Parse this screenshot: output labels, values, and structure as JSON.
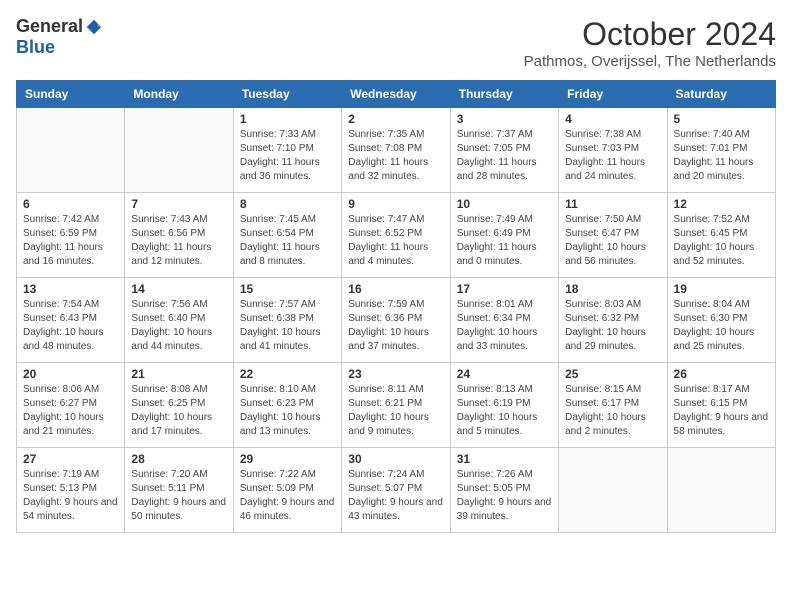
{
  "header": {
    "logo_general": "General",
    "logo_blue": "Blue",
    "month_year": "October 2024",
    "location": "Pathmos, Overijssel, The Netherlands"
  },
  "days_of_week": [
    "Sunday",
    "Monday",
    "Tuesday",
    "Wednesday",
    "Thursday",
    "Friday",
    "Saturday"
  ],
  "weeks": [
    [
      {
        "day": "",
        "content": ""
      },
      {
        "day": "",
        "content": ""
      },
      {
        "day": "1",
        "content": "Sunrise: 7:33 AM\nSunset: 7:10 PM\nDaylight: 11 hours and 36 minutes."
      },
      {
        "day": "2",
        "content": "Sunrise: 7:35 AM\nSunset: 7:08 PM\nDaylight: 11 hours and 32 minutes."
      },
      {
        "day": "3",
        "content": "Sunrise: 7:37 AM\nSunset: 7:05 PM\nDaylight: 11 hours and 28 minutes."
      },
      {
        "day": "4",
        "content": "Sunrise: 7:38 AM\nSunset: 7:03 PM\nDaylight: 11 hours and 24 minutes."
      },
      {
        "day": "5",
        "content": "Sunrise: 7:40 AM\nSunset: 7:01 PM\nDaylight: 11 hours and 20 minutes."
      }
    ],
    [
      {
        "day": "6",
        "content": "Sunrise: 7:42 AM\nSunset: 6:59 PM\nDaylight: 11 hours and 16 minutes."
      },
      {
        "day": "7",
        "content": "Sunrise: 7:43 AM\nSunset: 6:56 PM\nDaylight: 11 hours and 12 minutes."
      },
      {
        "day": "8",
        "content": "Sunrise: 7:45 AM\nSunset: 6:54 PM\nDaylight: 11 hours and 8 minutes."
      },
      {
        "day": "9",
        "content": "Sunrise: 7:47 AM\nSunset: 6:52 PM\nDaylight: 11 hours and 4 minutes."
      },
      {
        "day": "10",
        "content": "Sunrise: 7:49 AM\nSunset: 6:49 PM\nDaylight: 11 hours and 0 minutes."
      },
      {
        "day": "11",
        "content": "Sunrise: 7:50 AM\nSunset: 6:47 PM\nDaylight: 10 hours and 56 minutes."
      },
      {
        "day": "12",
        "content": "Sunrise: 7:52 AM\nSunset: 6:45 PM\nDaylight: 10 hours and 52 minutes."
      }
    ],
    [
      {
        "day": "13",
        "content": "Sunrise: 7:54 AM\nSunset: 6:43 PM\nDaylight: 10 hours and 48 minutes."
      },
      {
        "day": "14",
        "content": "Sunrise: 7:56 AM\nSunset: 6:40 PM\nDaylight: 10 hours and 44 minutes."
      },
      {
        "day": "15",
        "content": "Sunrise: 7:57 AM\nSunset: 6:38 PM\nDaylight: 10 hours and 41 minutes."
      },
      {
        "day": "16",
        "content": "Sunrise: 7:59 AM\nSunset: 6:36 PM\nDaylight: 10 hours and 37 minutes."
      },
      {
        "day": "17",
        "content": "Sunrise: 8:01 AM\nSunset: 6:34 PM\nDaylight: 10 hours and 33 minutes."
      },
      {
        "day": "18",
        "content": "Sunrise: 8:03 AM\nSunset: 6:32 PM\nDaylight: 10 hours and 29 minutes."
      },
      {
        "day": "19",
        "content": "Sunrise: 8:04 AM\nSunset: 6:30 PM\nDaylight: 10 hours and 25 minutes."
      }
    ],
    [
      {
        "day": "20",
        "content": "Sunrise: 8:06 AM\nSunset: 6:27 PM\nDaylight: 10 hours and 21 minutes."
      },
      {
        "day": "21",
        "content": "Sunrise: 8:08 AM\nSunset: 6:25 PM\nDaylight: 10 hours and 17 minutes."
      },
      {
        "day": "22",
        "content": "Sunrise: 8:10 AM\nSunset: 6:23 PM\nDaylight: 10 hours and 13 minutes."
      },
      {
        "day": "23",
        "content": "Sunrise: 8:11 AM\nSunset: 6:21 PM\nDaylight: 10 hours and 9 minutes."
      },
      {
        "day": "24",
        "content": "Sunrise: 8:13 AM\nSunset: 6:19 PM\nDaylight: 10 hours and 5 minutes."
      },
      {
        "day": "25",
        "content": "Sunrise: 8:15 AM\nSunset: 6:17 PM\nDaylight: 10 hours and 2 minutes."
      },
      {
        "day": "26",
        "content": "Sunrise: 8:17 AM\nSunset: 6:15 PM\nDaylight: 9 hours and 58 minutes."
      }
    ],
    [
      {
        "day": "27",
        "content": "Sunrise: 7:19 AM\nSunset: 5:13 PM\nDaylight: 9 hours and 54 minutes."
      },
      {
        "day": "28",
        "content": "Sunrise: 7:20 AM\nSunset: 5:11 PM\nDaylight: 9 hours and 50 minutes."
      },
      {
        "day": "29",
        "content": "Sunrise: 7:22 AM\nSunset: 5:09 PM\nDaylight: 9 hours and 46 minutes."
      },
      {
        "day": "30",
        "content": "Sunrise: 7:24 AM\nSunset: 5:07 PM\nDaylight: 9 hours and 43 minutes."
      },
      {
        "day": "31",
        "content": "Sunrise: 7:26 AM\nSunset: 5:05 PM\nDaylight: 9 hours and 39 minutes."
      },
      {
        "day": "",
        "content": ""
      },
      {
        "day": "",
        "content": ""
      }
    ]
  ]
}
